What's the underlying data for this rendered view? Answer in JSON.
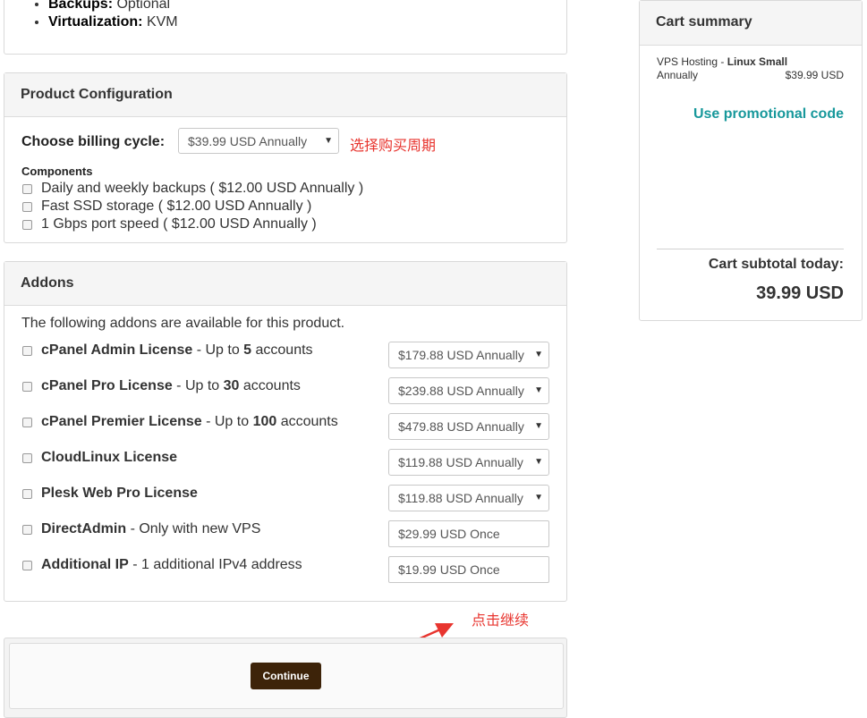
{
  "features": [
    {
      "label": "Backups:",
      "value": "Optional"
    },
    {
      "label": "Virtualization:",
      "value": "KVM"
    }
  ],
  "product_config": {
    "title": "Product Configuration",
    "billing_label": "Choose billing cycle:",
    "billing_value": "$39.99 USD Annually",
    "billing_annotation": "选择购买周期",
    "components_label": "Components",
    "components": [
      "Daily and weekly backups ( $12.00 USD Annually )",
      "Fast SSD storage ( $12.00 USD Annually )",
      "1 Gbps port speed ( $12.00 USD Annually )"
    ]
  },
  "addons": {
    "title": "Addons",
    "intro": "The following addons are available for this product.",
    "items": [
      {
        "name": "cPanel Admin License",
        "pre": " - Up to ",
        "bold": "5",
        "post": " accounts",
        "price": "$179.88 USD Annually",
        "kind": "select"
      },
      {
        "name": "cPanel Pro License",
        "pre": " - Up to ",
        "bold": "30",
        "post": " accounts",
        "price": "$239.88 USD Annually",
        "kind": "select"
      },
      {
        "name": "cPanel Premier License",
        "pre": " - Up to ",
        "bold": "100",
        "post": " accounts",
        "price": "$479.88 USD Annually",
        "kind": "select"
      },
      {
        "name": "CloudLinux License",
        "pre": "",
        "bold": "",
        "post": "",
        "price": "$119.88 USD Annually",
        "kind": "select"
      },
      {
        "name": "Plesk Web Pro License",
        "pre": "",
        "bold": "",
        "post": "",
        "price": "$119.88 USD Annually",
        "kind": "select"
      },
      {
        "name": "DirectAdmin",
        "pre": " - Only with new VPS",
        "bold": "",
        "post": "",
        "price": "$29.99 USD Once",
        "kind": "text"
      },
      {
        "name": "Additional IP",
        "pre": " - 1 additional IPv4 address",
        "bold": "",
        "post": "",
        "price": "$19.99 USD Once",
        "kind": "text"
      }
    ]
  },
  "continue": {
    "label": "Continue",
    "annotation": "点击继续",
    "button_color": "#3d2309",
    "annotation_color": "#e8352f"
  },
  "cart": {
    "title": "Cart summary",
    "product_prefix": "VPS Hosting - ",
    "product_name": "Linux Small",
    "cycle": "Annually",
    "price": "$39.99 USD",
    "promo": "Use promotional code",
    "promo_color": "#17989b",
    "subtotal_label": "Cart subtotal today:",
    "subtotal_value": "39.99 USD"
  }
}
